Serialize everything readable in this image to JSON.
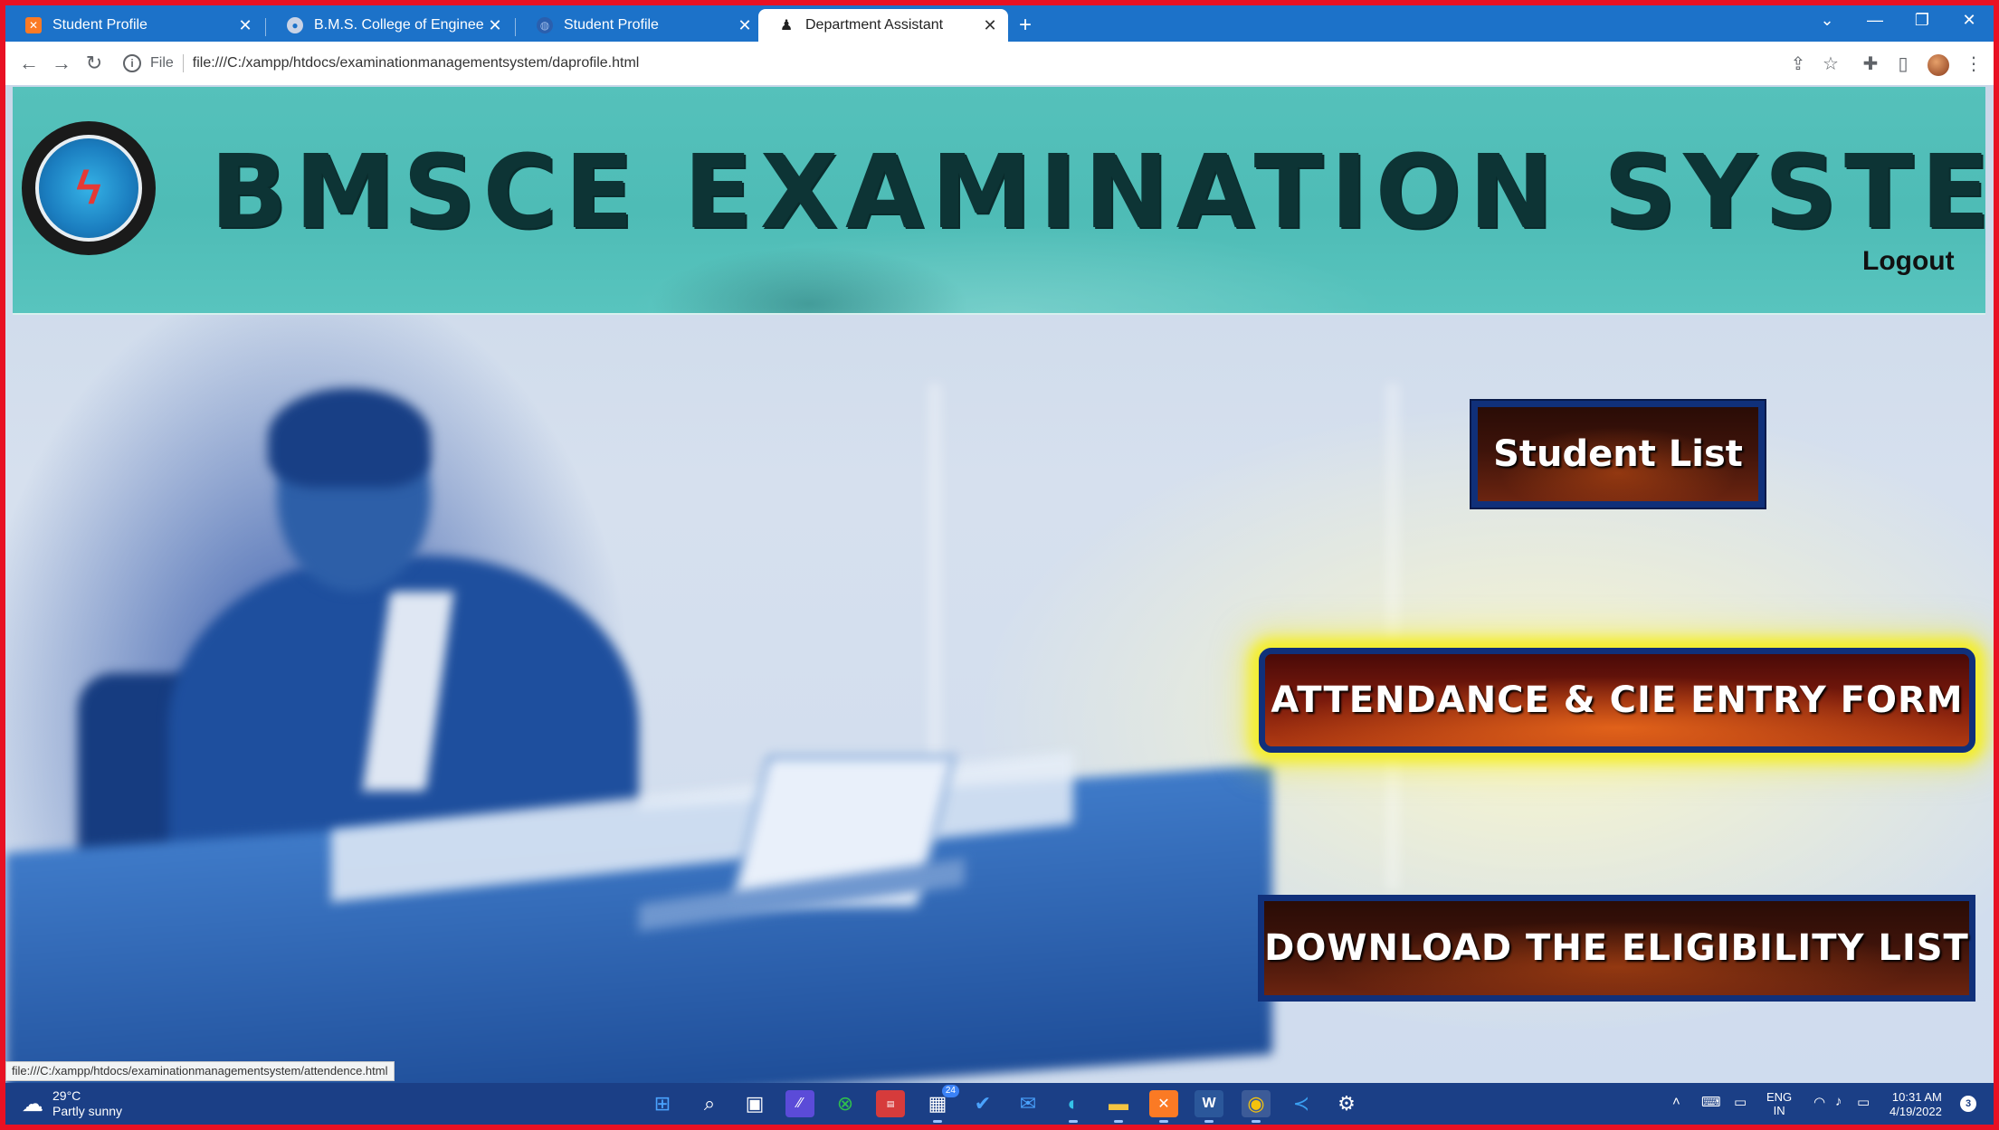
{
  "browser": {
    "tabs": [
      {
        "title": "Student Profile",
        "favicon": "xampp-icon",
        "active": false
      },
      {
        "title": "B.M.S. College of Engineering, Be",
        "favicon": "college-icon",
        "active": false
      },
      {
        "title": "Student Profile",
        "favicon": "globe-icon",
        "active": false
      },
      {
        "title": "Department Assistant",
        "favicon": "person-icon",
        "active": true
      }
    ],
    "close_glyph": "✕",
    "new_tab_glyph": "+",
    "url_scheme": "File",
    "url": "file:///C:/xampp/htdocs/examinationmanagementsystem/daprofile.html"
  },
  "header": {
    "title": "BMSCE EXAMINATION SYSTEM",
    "logout_label": "Logout"
  },
  "actions": {
    "student_list": "Student List",
    "attendance": "ATTENDANCE & CIE ENTRY FORM",
    "eligibility": "DOWNLOAD THE ELIGIBILITY LIST"
  },
  "status_bar": {
    "hover_url": "file:///C:/xampp/htdocs/examinationmanagementsystem/attendence.html"
  },
  "taskbar": {
    "weather": {
      "temp": "29°C",
      "desc": "Partly sunny"
    },
    "mail_badge": "24",
    "lang": {
      "line1": "ENG",
      "line2": "IN"
    },
    "clock": {
      "time": "10:31 AM",
      "date": "4/19/2022"
    },
    "notifications": "3"
  },
  "colors": {
    "banner": "#4ebcb6",
    "title_text": "#0d3435",
    "button_border": "#10307a",
    "highlight_glow": "#f4ee2c",
    "window_border": "#e81123"
  }
}
